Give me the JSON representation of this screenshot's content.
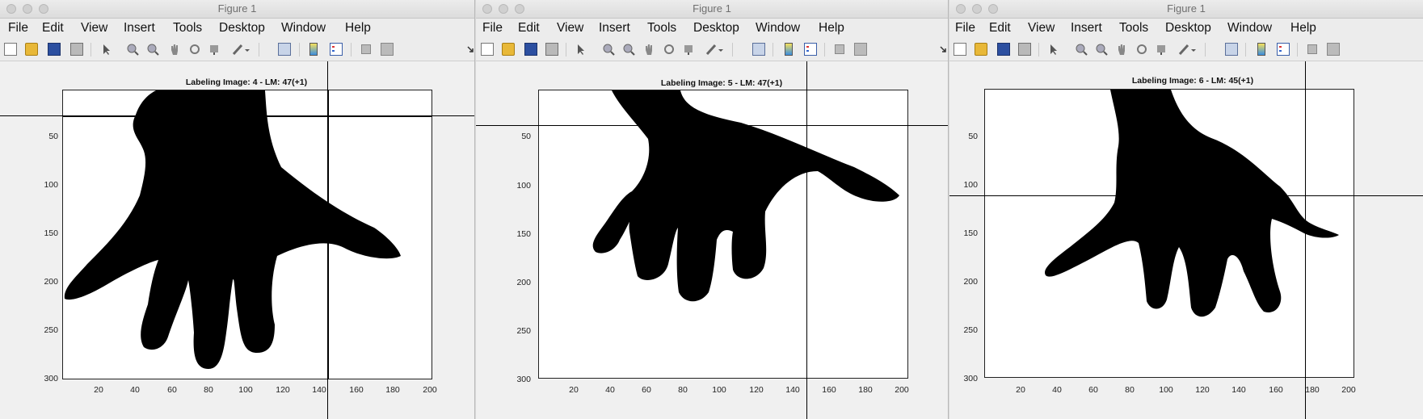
{
  "windows": [
    {
      "title": "Figure 1",
      "menu": [
        "File",
        "Edit",
        "View",
        "Insert",
        "Tools",
        "Desktop",
        "Window",
        "Help"
      ],
      "plot": {
        "title": "Labeling Image: 4 - LM: 47(+1)",
        "x_ticks": [
          "20",
          "40",
          "60",
          "80",
          "100",
          "120",
          "140",
          "160",
          "180",
          "200"
        ],
        "y_ticks": [
          "50",
          "100",
          "150",
          "200",
          "250",
          "300"
        ],
        "crosshair": {
          "x": 145,
          "y": 29
        }
      }
    },
    {
      "title": "Figure 1",
      "menu": [
        "File",
        "Edit",
        "View",
        "Insert",
        "Tools",
        "Desktop",
        "Window",
        "Help"
      ],
      "plot": {
        "title": "Labeling Image: 5 - LM: 47(+1)",
        "x_ticks": [
          "20",
          "40",
          "60",
          "80",
          "100",
          "120",
          "140",
          "160",
          "180",
          "200"
        ],
        "y_ticks": [
          "50",
          "100",
          "150",
          "200",
          "250",
          "300"
        ],
        "crosshair": {
          "x": 147,
          "y": 38
        }
      }
    },
    {
      "title": "Figure 1",
      "menu": [
        "File",
        "Edit",
        "View",
        "Insert",
        "Tools",
        "Desktop",
        "Window",
        "Help"
      ],
      "plot": {
        "title": "Labeling Image: 6 - LM: 45(+1)",
        "x_ticks": [
          "20",
          "40",
          "60",
          "80",
          "100",
          "120",
          "140",
          "160",
          "180",
          "200"
        ],
        "y_ticks": [
          "50",
          "100",
          "150",
          "200",
          "250",
          "300"
        ],
        "crosshair": {
          "x": 162,
          "y": 111
        }
      }
    }
  ],
  "toolbar_icons": [
    "new-figure-icon",
    "open-file-icon",
    "save-icon",
    "print-icon",
    "select-arrow-icon",
    "zoom-in-icon",
    "zoom-out-icon",
    "pan-hand-icon",
    "rotate-3d-icon",
    "data-cursor-icon",
    "brush-icon",
    "link-plot-icon",
    "colorbar-icon",
    "legend-icon",
    "hide-plot-tools-icon",
    "show-plot-tools-icon",
    "dock-arrow-icon"
  ],
  "colors": {
    "landmark": "#00e5ff",
    "crosshair": "#000000",
    "hand": "#000000"
  }
}
